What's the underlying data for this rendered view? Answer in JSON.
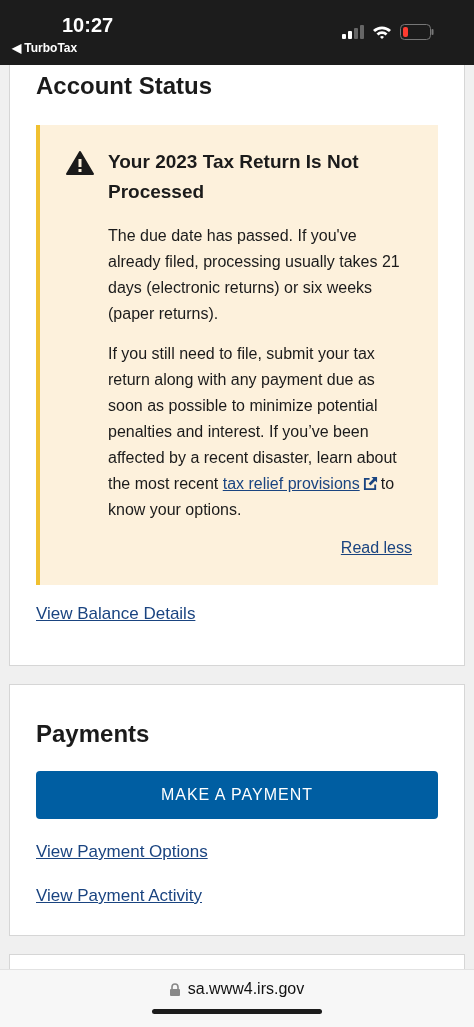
{
  "status_bar": {
    "time": "10:27",
    "back_label": "◀ TurboTax"
  },
  "account_status": {
    "title": "Account Status",
    "alert": {
      "title": "Your 2023 Tax Return Is Not Processed",
      "paragraphs": [
        {
          "text": "The due date has passed. If you've already filed, processing usually takes 21 days (electronic returns) or six weeks (paper returns)."
        },
        {
          "text": "If you still need to file, submit your tax return along with any payment due as soon as possible to minimize potential penalties and interest. If you’ve been affected by a recent disaster, learn about the most recent",
          "link": "tax relief provisions",
          "text_after": "to know your options."
        }
      ],
      "toggle_link": "Read less"
    },
    "link": "View Balance Details"
  },
  "payments": {
    "title": "Payments",
    "button": "MAKE A PAYMENT",
    "links": [
      "View Payment Options",
      "View Payment Activity"
    ]
  },
  "address_bar": {
    "url": "sa.www4.irs.gov"
  }
}
